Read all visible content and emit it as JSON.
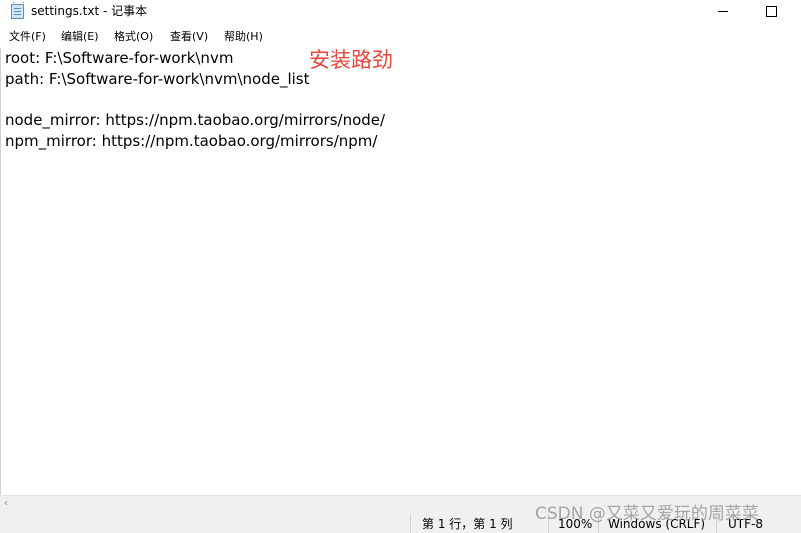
{
  "window": {
    "title": "settings.txt - 记事本",
    "minimize_glyph": "",
    "maximize_glyph": ""
  },
  "menu": {
    "items": [
      "文件(F)",
      "编辑(E)",
      "格式(O)",
      "查看(V)",
      "帮助(H)"
    ]
  },
  "editor": {
    "lines": [
      "root: F:\\Software-for-work\\nvm",
      "path: F:\\Software-for-work\\nvm\\node_list",
      "",
      "node_mirror: https://npm.taobao.org/mirrors/node/",
      "npm_mirror: https://npm.taobao.org/mirrors/npm/"
    ],
    "annotation": "安装路劲",
    "annotation_color": "#e9463c"
  },
  "statusbar": {
    "position": "第 1 行，第 1 列",
    "zoom": "100%",
    "line_ending": "Windows (CRLF)",
    "encoding": "UTF-8"
  },
  "watermark": "CSDN @又菜又爱玩的周菜菜",
  "icons": {
    "app": "notepad-icon",
    "scroll_left": "chevron-left-icon"
  }
}
